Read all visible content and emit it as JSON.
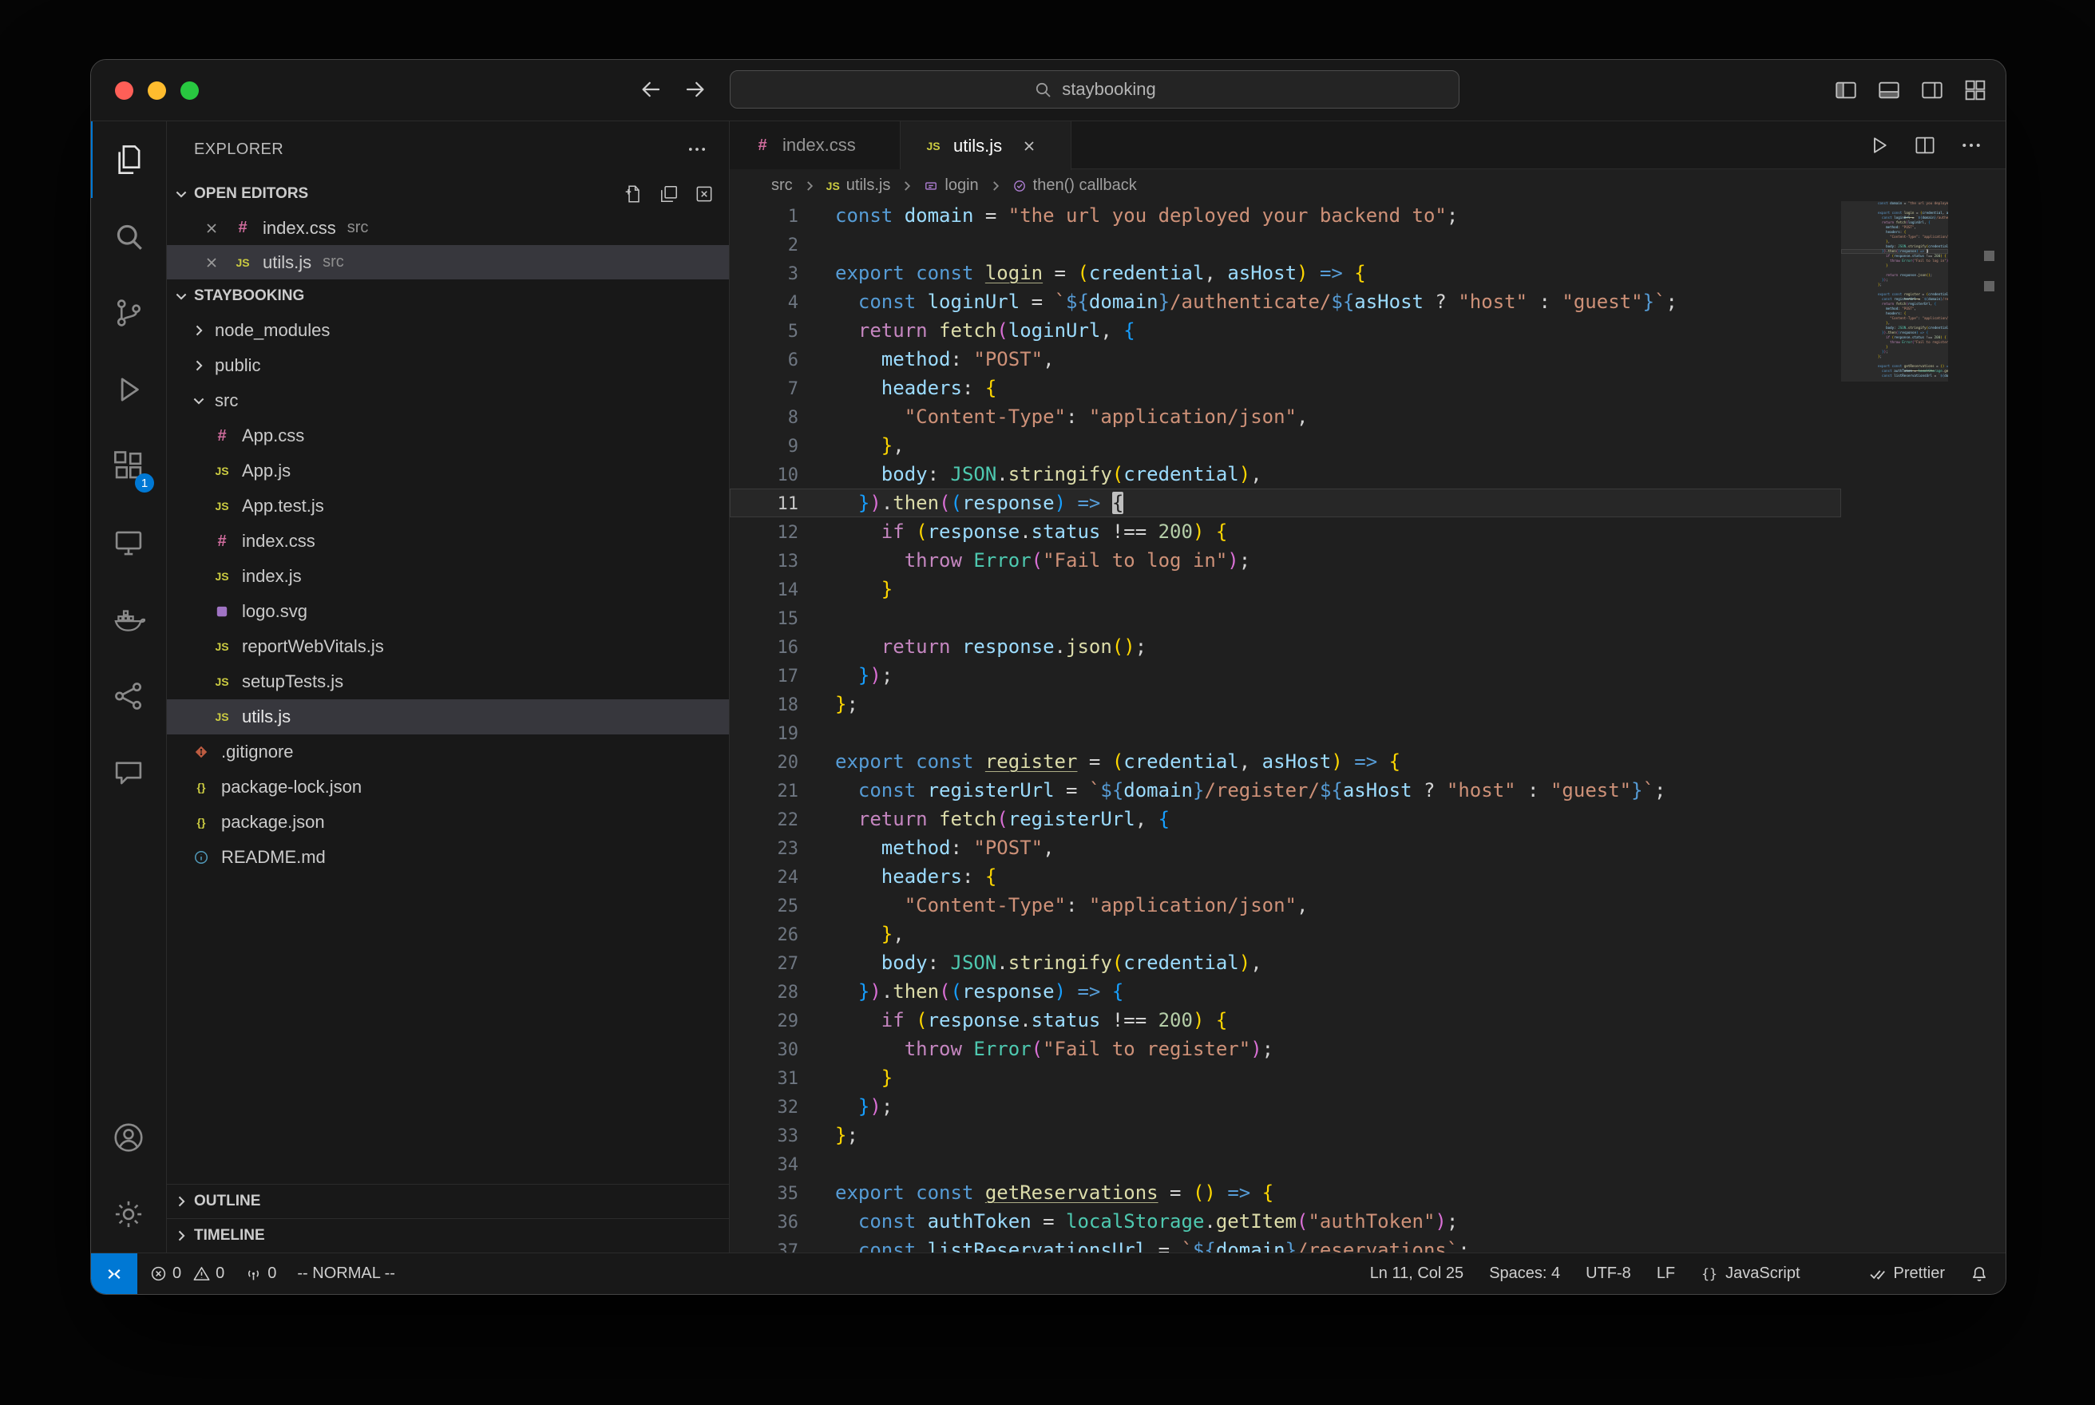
{
  "colors": {
    "accent": "#0078d4",
    "traffic_lights": [
      "#ff5f57",
      "#febc2e",
      "#28c840"
    ],
    "syntax": {
      "kw": "#569cd6",
      "ctrl": "#c586c0",
      "fn": "#dcdcaa",
      "vr": "#9cdcfe",
      "st": "#ce9178",
      "nm": "#b5cea8",
      "cl": "#4ec9b0",
      "pl": "#d4d4d4",
      "te": "#569cd6",
      "b1": "#ffd700",
      "b2": "#da70d6",
      "b3": "#179fff"
    }
  },
  "titlebar": {
    "search_text": "staybooking"
  },
  "activity_bar": {
    "top_items": [
      {
        "id": "explorer",
        "icon": "files",
        "active": true
      },
      {
        "id": "search",
        "icon": "search"
      },
      {
        "id": "source-control",
        "icon": "source-control"
      },
      {
        "id": "run-debug",
        "icon": "run-debug"
      },
      {
        "id": "extensions",
        "icon": "extensions",
        "badge": "1"
      },
      {
        "id": "remote-explorer",
        "icon": "remote-explorer"
      },
      {
        "id": "docker",
        "icon": "docker"
      },
      {
        "id": "live-share",
        "icon": "live-share"
      },
      {
        "id": "chat",
        "icon": "chat"
      }
    ],
    "bottom_items": [
      {
        "id": "account",
        "icon": "account"
      },
      {
        "id": "settings",
        "icon": "settings"
      }
    ]
  },
  "sidebar": {
    "title": "EXPLORER",
    "open_editors": {
      "label": "OPEN EDITORS",
      "items": [
        {
          "name": "index.css",
          "detail": "src",
          "icon": "css"
        },
        {
          "name": "utils.js",
          "detail": "src",
          "icon": "js",
          "active": true
        }
      ]
    },
    "project": {
      "label": "STAYBOOKING",
      "tree": [
        {
          "label": "node_modules",
          "type": "folder",
          "state": "collapsed",
          "indent": 1
        },
        {
          "label": "public",
          "type": "folder",
          "state": "collapsed",
          "indent": 1
        },
        {
          "label": "src",
          "type": "folder",
          "state": "expanded",
          "indent": 1
        },
        {
          "label": "App.css",
          "icon": "css",
          "indent": 2
        },
        {
          "label": "App.js",
          "icon": "js",
          "indent": 2
        },
        {
          "label": "App.test.js",
          "icon": "js",
          "indent": 2
        },
        {
          "label": "index.css",
          "icon": "css",
          "indent": 2
        },
        {
          "label": "index.js",
          "icon": "js",
          "indent": 2
        },
        {
          "label": "logo.svg",
          "icon": "svg",
          "indent": 2
        },
        {
          "label": "reportWebVitals.js",
          "icon": "js",
          "indent": 2
        },
        {
          "label": "setupTests.js",
          "icon": "js",
          "indent": 2
        },
        {
          "label": "utils.js",
          "icon": "js",
          "indent": 2,
          "selected": true
        },
        {
          "label": ".gitignore",
          "icon": "git",
          "indent": 1
        },
        {
          "label": "package-lock.json",
          "icon": "json",
          "indent": 1
        },
        {
          "label": "package.json",
          "icon": "json",
          "indent": 1
        },
        {
          "label": "README.md",
          "icon": "info",
          "indent": 1
        }
      ]
    },
    "footer": [
      {
        "label": "OUTLINE"
      },
      {
        "label": "TIMELINE"
      }
    ]
  },
  "editor": {
    "tabs": [
      {
        "name": "index.css",
        "icon": "css"
      },
      {
        "name": "utils.js",
        "icon": "js",
        "active": true
      }
    ],
    "breadcrumb": [
      {
        "label": "src"
      },
      {
        "label": "utils.js",
        "icon": "js-file"
      },
      {
        "label": "login",
        "icon": "symbol-constant"
      },
      {
        "label": "then() callback",
        "icon": "symbol-callback"
      }
    ],
    "active_line": 11,
    "lines": [
      [
        [
          "kw",
          "const"
        ],
        [
          "pl",
          " "
        ],
        [
          "vr",
          "domain"
        ],
        [
          "pl",
          " = "
        ],
        [
          "st",
          "\"the url you deployed your backend to\""
        ],
        [
          "pl",
          ";"
        ]
      ],
      [],
      [
        [
          "kw",
          "export"
        ],
        [
          "pl",
          " "
        ],
        [
          "kw",
          "const"
        ],
        [
          "pl",
          " "
        ],
        [
          "df",
          "login"
        ],
        [
          "pl",
          " = "
        ],
        [
          "b1",
          "("
        ],
        [
          "vr",
          "credential"
        ],
        [
          "pl",
          ", "
        ],
        [
          "vr",
          "asHost"
        ],
        [
          "b1",
          ")"
        ],
        [
          "pl",
          " "
        ],
        [
          "kw",
          "=>"
        ],
        [
          "pl",
          " "
        ],
        [
          "b1",
          "{"
        ]
      ],
      [
        [
          "pl",
          "  "
        ],
        [
          "kw",
          "const"
        ],
        [
          "pl",
          " "
        ],
        [
          "vr",
          "loginUrl"
        ],
        [
          "pl",
          " = "
        ],
        [
          "st",
          "`"
        ],
        [
          "te",
          "${"
        ],
        [
          "vr",
          "domain"
        ],
        [
          "te",
          "}"
        ],
        [
          "st",
          "/authenticate/"
        ],
        [
          "te",
          "${"
        ],
        [
          "vr",
          "asHost"
        ],
        [
          "pl",
          " ? "
        ],
        [
          "st",
          "\"host\""
        ],
        [
          "pl",
          " : "
        ],
        [
          "st",
          "\"guest\""
        ],
        [
          "te",
          "}"
        ],
        [
          "st",
          "`"
        ],
        [
          "pl",
          ";"
        ]
      ],
      [
        [
          "pl",
          "  "
        ],
        [
          "ctrl",
          "return"
        ],
        [
          "pl",
          " "
        ],
        [
          "fn",
          "fetch"
        ],
        [
          "b2",
          "("
        ],
        [
          "vr",
          "loginUrl"
        ],
        [
          "pl",
          ", "
        ],
        [
          "b3",
          "{"
        ]
      ],
      [
        [
          "pl",
          "    "
        ],
        [
          "vr",
          "method"
        ],
        [
          "pl",
          ": "
        ],
        [
          "st",
          "\"POST\""
        ],
        [
          "pl",
          ","
        ]
      ],
      [
        [
          "pl",
          "    "
        ],
        [
          "vr",
          "headers"
        ],
        [
          "pl",
          ": "
        ],
        [
          "b1",
          "{"
        ]
      ],
      [
        [
          "pl",
          "      "
        ],
        [
          "st",
          "\"Content-Type\""
        ],
        [
          "pl",
          ": "
        ],
        [
          "st",
          "\"application/json\""
        ],
        [
          "pl",
          ","
        ]
      ],
      [
        [
          "pl",
          "    "
        ],
        [
          "b1",
          "}"
        ],
        [
          "pl",
          ","
        ]
      ],
      [
        [
          "pl",
          "    "
        ],
        [
          "vr",
          "body"
        ],
        [
          "pl",
          ": "
        ],
        [
          "cl",
          "JSON"
        ],
        [
          "pl",
          "."
        ],
        [
          "fn",
          "stringify"
        ],
        [
          "b1",
          "("
        ],
        [
          "vr",
          "credential"
        ],
        [
          "b1",
          ")"
        ],
        [
          "pl",
          ","
        ]
      ],
      [
        [
          "pl",
          "  "
        ],
        [
          "b3",
          "}"
        ],
        [
          "b2",
          ")"
        ],
        [
          "pl",
          "."
        ],
        [
          "fn",
          "then"
        ],
        [
          "b2",
          "("
        ],
        [
          "b3",
          "("
        ],
        [
          "vr",
          "response"
        ],
        [
          "b3",
          ")"
        ],
        [
          "pl",
          " "
        ],
        [
          "kw",
          "=>"
        ],
        [
          "pl",
          " "
        ],
        [
          "cursor",
          "{"
        ]
      ],
      [
        [
          "pl",
          "    "
        ],
        [
          "ctrl",
          "if"
        ],
        [
          "pl",
          " "
        ],
        [
          "b1",
          "("
        ],
        [
          "vr",
          "response"
        ],
        [
          "pl",
          "."
        ],
        [
          "vr",
          "status"
        ],
        [
          "pl",
          " !== "
        ],
        [
          "nm",
          "200"
        ],
        [
          "b1",
          ")"
        ],
        [
          "pl",
          " "
        ],
        [
          "b1",
          "{"
        ]
      ],
      [
        [
          "pl",
          "      "
        ],
        [
          "ctrl",
          "throw"
        ],
        [
          "pl",
          " "
        ],
        [
          "cl",
          "Error"
        ],
        [
          "b2",
          "("
        ],
        [
          "st",
          "\"Fail to log in\""
        ],
        [
          "b2",
          ")"
        ],
        [
          "pl",
          ";"
        ]
      ],
      [
        [
          "pl",
          "    "
        ],
        [
          "b1",
          "}"
        ]
      ],
      [],
      [
        [
          "pl",
          "    "
        ],
        [
          "ctrl",
          "return"
        ],
        [
          "pl",
          " "
        ],
        [
          "vr",
          "response"
        ],
        [
          "pl",
          "."
        ],
        [
          "fn",
          "json"
        ],
        [
          "b1",
          "("
        ],
        [
          "b1",
          ")"
        ],
        [
          "pl",
          ";"
        ]
      ],
      [
        [
          "pl",
          "  "
        ],
        [
          "b3",
          "}"
        ],
        [
          "b2",
          ")"
        ],
        [
          "pl",
          ";"
        ]
      ],
      [
        [
          "b1",
          "}"
        ],
        [
          "pl",
          ";"
        ]
      ],
      [],
      [
        [
          "kw",
          "export"
        ],
        [
          "pl",
          " "
        ],
        [
          "kw",
          "const"
        ],
        [
          "pl",
          " "
        ],
        [
          "df",
          "register"
        ],
        [
          "pl",
          " = "
        ],
        [
          "b1",
          "("
        ],
        [
          "vr",
          "credential"
        ],
        [
          "pl",
          ", "
        ],
        [
          "vr",
          "asHost"
        ],
        [
          "b1",
          ")"
        ],
        [
          "pl",
          " "
        ],
        [
          "kw",
          "=>"
        ],
        [
          "pl",
          " "
        ],
        [
          "b1",
          "{"
        ]
      ],
      [
        [
          "pl",
          "  "
        ],
        [
          "kw",
          "const"
        ],
        [
          "pl",
          " "
        ],
        [
          "vr",
          "registerUrl"
        ],
        [
          "pl",
          " = "
        ],
        [
          "st",
          "`"
        ],
        [
          "te",
          "${"
        ],
        [
          "vr",
          "domain"
        ],
        [
          "te",
          "}"
        ],
        [
          "st",
          "/register/"
        ],
        [
          "te",
          "${"
        ],
        [
          "vr",
          "asHost"
        ],
        [
          "pl",
          " ? "
        ],
        [
          "st",
          "\"host\""
        ],
        [
          "pl",
          " : "
        ],
        [
          "st",
          "\"guest\""
        ],
        [
          "te",
          "}"
        ],
        [
          "st",
          "`"
        ],
        [
          "pl",
          ";"
        ]
      ],
      [
        [
          "pl",
          "  "
        ],
        [
          "ctrl",
          "return"
        ],
        [
          "pl",
          " "
        ],
        [
          "fn",
          "fetch"
        ],
        [
          "b2",
          "("
        ],
        [
          "vr",
          "registerUrl"
        ],
        [
          "pl",
          ", "
        ],
        [
          "b3",
          "{"
        ]
      ],
      [
        [
          "pl",
          "    "
        ],
        [
          "vr",
          "method"
        ],
        [
          "pl",
          ": "
        ],
        [
          "st",
          "\"POST\""
        ],
        [
          "pl",
          ","
        ]
      ],
      [
        [
          "pl",
          "    "
        ],
        [
          "vr",
          "headers"
        ],
        [
          "pl",
          ": "
        ],
        [
          "b1",
          "{"
        ]
      ],
      [
        [
          "pl",
          "      "
        ],
        [
          "st",
          "\"Content-Type\""
        ],
        [
          "pl",
          ": "
        ],
        [
          "st",
          "\"application/json\""
        ],
        [
          "pl",
          ","
        ]
      ],
      [
        [
          "pl",
          "    "
        ],
        [
          "b1",
          "}"
        ],
        [
          "pl",
          ","
        ]
      ],
      [
        [
          "pl",
          "    "
        ],
        [
          "vr",
          "body"
        ],
        [
          "pl",
          ": "
        ],
        [
          "cl",
          "JSON"
        ],
        [
          "pl",
          "."
        ],
        [
          "fn",
          "stringify"
        ],
        [
          "b1",
          "("
        ],
        [
          "vr",
          "credential"
        ],
        [
          "b1",
          ")"
        ],
        [
          "pl",
          ","
        ]
      ],
      [
        [
          "pl",
          "  "
        ],
        [
          "b3",
          "}"
        ],
        [
          "b2",
          ")"
        ],
        [
          "pl",
          "."
        ],
        [
          "fn",
          "then"
        ],
        [
          "b2",
          "("
        ],
        [
          "b3",
          "("
        ],
        [
          "vr",
          "response"
        ],
        [
          "b3",
          ")"
        ],
        [
          "pl",
          " "
        ],
        [
          "kw",
          "=>"
        ],
        [
          "pl",
          " "
        ],
        [
          "b3",
          "{"
        ]
      ],
      [
        [
          "pl",
          "    "
        ],
        [
          "ctrl",
          "if"
        ],
        [
          "pl",
          " "
        ],
        [
          "b1",
          "("
        ],
        [
          "vr",
          "response"
        ],
        [
          "pl",
          "."
        ],
        [
          "vr",
          "status"
        ],
        [
          "pl",
          " !== "
        ],
        [
          "nm",
          "200"
        ],
        [
          "b1",
          ")"
        ],
        [
          "pl",
          " "
        ],
        [
          "b1",
          "{"
        ]
      ],
      [
        [
          "pl",
          "      "
        ],
        [
          "ctrl",
          "throw"
        ],
        [
          "pl",
          " "
        ],
        [
          "cl",
          "Error"
        ],
        [
          "b2",
          "("
        ],
        [
          "st",
          "\"Fail to register\""
        ],
        [
          "b2",
          ")"
        ],
        [
          "pl",
          ";"
        ]
      ],
      [
        [
          "pl",
          "    "
        ],
        [
          "b1",
          "}"
        ]
      ],
      [
        [
          "pl",
          "  "
        ],
        [
          "b3",
          "}"
        ],
        [
          "b2",
          ")"
        ],
        [
          "pl",
          ";"
        ]
      ],
      [
        [
          "b1",
          "}"
        ],
        [
          "pl",
          ";"
        ]
      ],
      [],
      [
        [
          "kw",
          "export"
        ],
        [
          "pl",
          " "
        ],
        [
          "kw",
          "const"
        ],
        [
          "pl",
          " "
        ],
        [
          "df",
          "getReservations"
        ],
        [
          "pl",
          " = "
        ],
        [
          "b1",
          "("
        ],
        [
          "b1",
          ")"
        ],
        [
          "pl",
          " "
        ],
        [
          "kw",
          "=>"
        ],
        [
          "pl",
          " "
        ],
        [
          "b1",
          "{"
        ]
      ],
      [
        [
          "pl",
          "  "
        ],
        [
          "kw",
          "const"
        ],
        [
          "pl",
          " "
        ],
        [
          "vr",
          "authToken"
        ],
        [
          "pl",
          " = "
        ],
        [
          "cl",
          "localStorage"
        ],
        [
          "pl",
          "."
        ],
        [
          "fn",
          "getItem"
        ],
        [
          "b2",
          "("
        ],
        [
          "st",
          "\"authToken\""
        ],
        [
          "b2",
          ")"
        ],
        [
          "pl",
          ";"
        ]
      ],
      [
        [
          "pl",
          "  "
        ],
        [
          "kw",
          "const"
        ],
        [
          "pl",
          " "
        ],
        [
          "vr",
          "listReservationsUrl"
        ],
        [
          "pl",
          " = "
        ],
        [
          "st",
          "`"
        ],
        [
          "te",
          "${"
        ],
        [
          "vr",
          "domain"
        ],
        [
          "te",
          "}"
        ],
        [
          "st",
          "/reservations`"
        ],
        [
          "pl",
          ";"
        ]
      ]
    ]
  },
  "status_bar": {
    "errors": "0",
    "warnings": "0",
    "ports": "0",
    "vim_mode": "-- NORMAL --",
    "cursor_position": "Ln 11, Col 25",
    "indentation": "Spaces: 4",
    "encoding": "UTF-8",
    "eol": "LF",
    "language": "JavaScript",
    "formatter": "Prettier"
  }
}
